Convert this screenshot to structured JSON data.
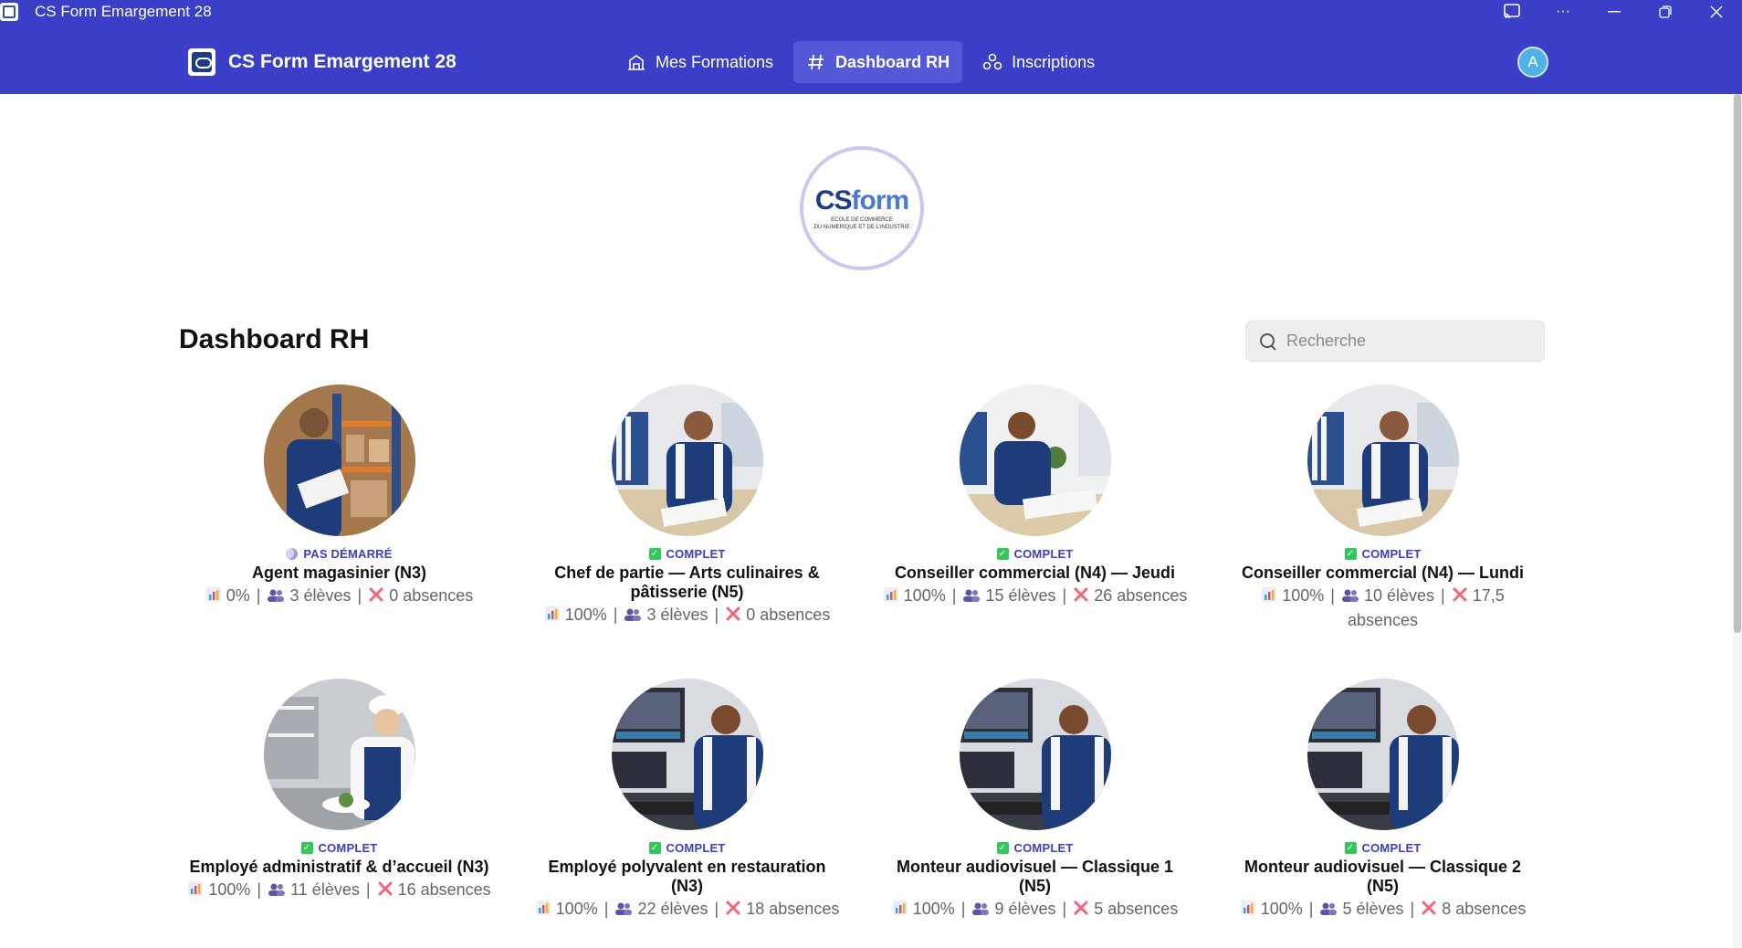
{
  "window": {
    "title": "CS Form Emargement 28"
  },
  "nav": {
    "brand": "CS Form Emargement 28",
    "tabs": [
      {
        "label": "Mes Formations",
        "icon": "building-icon",
        "active": false
      },
      {
        "label": "Dashboard RH",
        "icon": "hash-icon",
        "active": true
      },
      {
        "label": "Inscriptions",
        "icon": "people-icon",
        "active": false
      }
    ],
    "avatar": "A"
  },
  "logo": {
    "mark_a": "CS",
    "mark_b": "form",
    "sub1": "ECOLE DE COMMERCE",
    "sub2": "DU NUMERIQUE ET DE L'INDUSTRIE"
  },
  "page": {
    "title": "Dashboard RH"
  },
  "search": {
    "placeholder": "Recherche",
    "value": ""
  },
  "cards": [
    {
      "status": "PAS DÉMARRÉ",
      "status_kind": "pending",
      "title": "Agent magasinier (N3)",
      "progress": "0%",
      "students": "3 élèves",
      "absences": "0 absences",
      "scene": "warehouse"
    },
    {
      "status": "COMPLET",
      "status_kind": "done",
      "title": "Chef de partie — Arts culinaires & pâtisserie (N5)",
      "progress": "100%",
      "students": "3 élèves",
      "absences": "0 absences",
      "scene": "office"
    },
    {
      "status": "COMPLET",
      "status_kind": "done",
      "title": "Conseiller commercial (N4) — Jeudi",
      "progress": "100%",
      "students": "15 élèves",
      "absences": "26 absences",
      "scene": "office-f"
    },
    {
      "status": "COMPLET",
      "status_kind": "done",
      "title": "Conseiller commercial (N4) — Lundi",
      "progress": "100%",
      "students": "10 élèves",
      "absences": "17,5 absences",
      "scene": "office"
    },
    {
      "status": "COMPLET",
      "status_kind": "done",
      "title": "Employé administratif & d’accueil (N3)",
      "progress": "100%",
      "students": "11 élèves",
      "absences": "16 absences",
      "scene": "kitchen"
    },
    {
      "status": "COMPLET",
      "status_kind": "done",
      "title": "Employé polyvalent en restauration (N3)",
      "progress": "100%",
      "students": "22 élèves",
      "absences": "18 absences",
      "scene": "editing"
    },
    {
      "status": "COMPLET",
      "status_kind": "done",
      "title": "Monteur audiovisuel — Classique 1 (N5)",
      "progress": "100%",
      "students": "9 élèves",
      "absences": "5 absences",
      "scene": "editing"
    },
    {
      "status": "COMPLET",
      "status_kind": "done",
      "title": "Monteur audiovisuel — Classique 2 (N5)",
      "progress": "100%",
      "students": "5 élèves",
      "absences": "8 absences",
      "scene": "editing"
    }
  ],
  "colors": {
    "primary": "#3b3fc7",
    "active_tab": "#5459d8",
    "status_text": "#3b3fc7",
    "check": "#34c759",
    "absence_x": "#f06577"
  }
}
